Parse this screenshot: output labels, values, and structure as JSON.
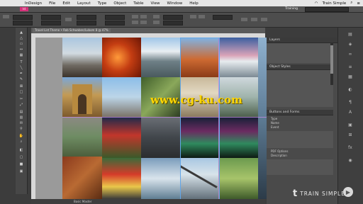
{
  "menubar": {
    "apple": "",
    "items": [
      "InDesign",
      "File",
      "Edit",
      "Layout",
      "Type",
      "Object",
      "Table",
      "View",
      "Window",
      "Help"
    ],
    "right_text": "Train Simple"
  },
  "appbar": {
    "app_badge": "Id",
    "workspace": "Training"
  },
  "document_tab": "Travel List Theme • Rob Schwaben/Lubom 8 @ 47%",
  "status": {
    "page": "Basic Master"
  },
  "panels": {
    "layers_title": "Layers",
    "object_title": "Object Styles",
    "buttons_title": "Buttons and Forms",
    "rows": [
      "Type",
      "Name",
      "Event",
      "PDF Options",
      "Description"
    ]
  },
  "brand": {
    "logo": "t",
    "text": "TRAIN SIMPLE"
  },
  "watermark": "www.cg-ku.com",
  "colors": {
    "accent": "#63a6e8",
    "margin": "#c08be0",
    "watermark": "#ffd600"
  }
}
